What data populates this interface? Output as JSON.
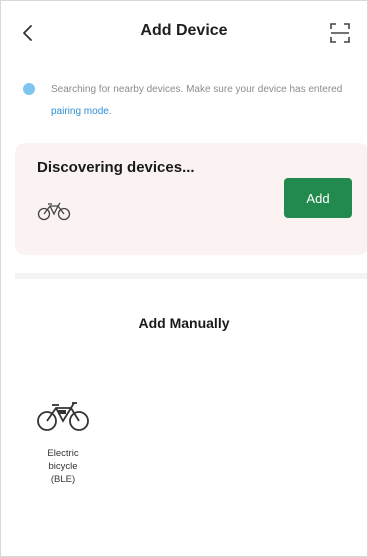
{
  "header": {
    "title": "Add Device",
    "back_icon": "chevron-left-icon",
    "scan_icon": "scan-icon"
  },
  "info": {
    "text_before": "Searching for nearby devices. Make sure your device has entered ",
    "link": "pairing mode",
    "text_after": "."
  },
  "discover": {
    "title": "Discovering devices...",
    "device_icon": "bicycle-icon",
    "add_label": "Add"
  },
  "manual": {
    "title": "Add Manually",
    "devices": [
      {
        "label": "Electric bicycle (BLE)",
        "label_lines": "Electric\nbicycle\n(BLE)",
        "icon": "electric-bicycle-icon"
      }
    ]
  },
  "colors": {
    "accent_green": "#238a4d",
    "link_blue": "#2f8fd6",
    "card_background": "#fbf3f2",
    "info_dot": "#7cc6f0"
  }
}
